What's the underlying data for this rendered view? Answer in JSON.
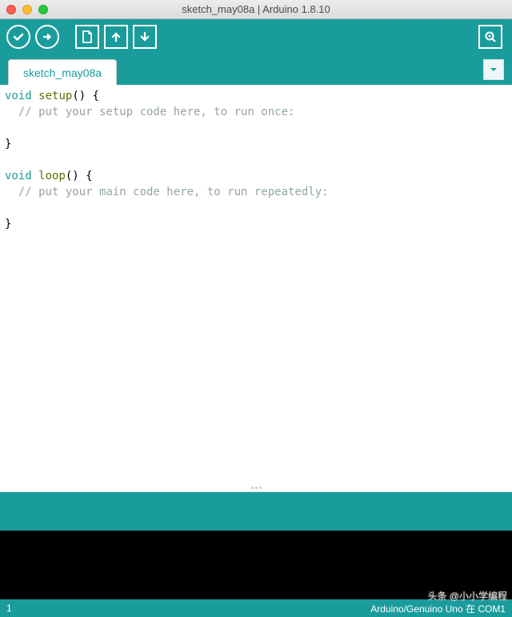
{
  "window": {
    "title": "sketch_may08a | Arduino 1.8.10"
  },
  "tabs": {
    "active": "sketch_may08a"
  },
  "code": {
    "lines": [
      {
        "segments": [
          {
            "t": "void",
            "c": "kw"
          },
          {
            "t": " "
          },
          {
            "t": "setup",
            "c": "fn"
          },
          {
            "t": "() {"
          }
        ]
      },
      {
        "segments": [
          {
            "t": "  // put your setup code here, to run once:",
            "c": "cm"
          }
        ]
      },
      {
        "segments": [
          {
            "t": " "
          }
        ]
      },
      {
        "segments": [
          {
            "t": "}"
          }
        ]
      },
      {
        "segments": [
          {
            "t": " "
          }
        ]
      },
      {
        "segments": [
          {
            "t": "void",
            "c": "kw"
          },
          {
            "t": " "
          },
          {
            "t": "loop",
            "c": "fn"
          },
          {
            "t": "() {"
          }
        ]
      },
      {
        "segments": [
          {
            "t": "  // put your main code here, to run repeatedly:",
            "c": "cm"
          }
        ]
      },
      {
        "segments": [
          {
            "t": " "
          }
        ]
      },
      {
        "segments": [
          {
            "t": "}"
          }
        ]
      }
    ]
  },
  "footer": {
    "line": "1",
    "board": "Arduino/Genuino Uno 在 COM1"
  },
  "watermark": "头条 @小小学编程"
}
